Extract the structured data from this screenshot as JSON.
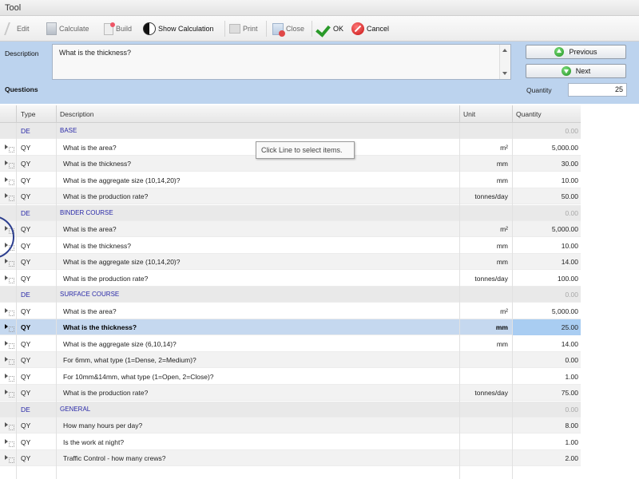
{
  "window": {
    "title": "Tool"
  },
  "toolbar": {
    "edit": "Edit",
    "calculate": "Calculate",
    "build": "Build",
    "show_calculation": "Show Calculation",
    "print": "Print",
    "close": "Close",
    "ok": "OK",
    "cancel": "Cancel"
  },
  "top_panel": {
    "description_label": "Description",
    "description_value": "What is the thickness?",
    "previous_label": "Previous",
    "next_label": "Next",
    "questions_label": "Questions",
    "quantity_label": "Quantity",
    "quantity_value": "25"
  },
  "grid": {
    "columns": {
      "type": "Type",
      "description": "Description",
      "unit": "Unit",
      "quantity": "Quantity"
    },
    "rows": [
      {
        "type": "DE",
        "description": "BASE",
        "unit": "",
        "quantity": "0.00",
        "kind": "de"
      },
      {
        "type": "QY",
        "description": "What is the area?",
        "unit": "m²",
        "quantity": "5,000.00",
        "kind": "qy"
      },
      {
        "type": "QY",
        "description": "What is the thickness?",
        "unit": "mm",
        "quantity": "30.00",
        "kind": "qy"
      },
      {
        "type": "QY",
        "description": "What is the aggregate size (10,14,20)?",
        "unit": "mm",
        "quantity": "10.00",
        "kind": "qy"
      },
      {
        "type": "QY",
        "description": "What is the production rate?",
        "unit": "tonnes/day",
        "quantity": "50.00",
        "kind": "qy"
      },
      {
        "type": "DE",
        "description": "BINDER COURSE",
        "unit": "",
        "quantity": "0.00",
        "kind": "de"
      },
      {
        "type": "QY",
        "description": "What is the area?",
        "unit": "m²",
        "quantity": "5,000.00",
        "kind": "qy"
      },
      {
        "type": "QY",
        "description": "What is the thickness?",
        "unit": "mm",
        "quantity": "10.00",
        "kind": "qy"
      },
      {
        "type": "QY",
        "description": "What is the aggregate size (10,14,20)?",
        "unit": "mm",
        "quantity": "14.00",
        "kind": "qy"
      },
      {
        "type": "QY",
        "description": "What is the production rate?",
        "unit": "tonnes/day",
        "quantity": "100.00",
        "kind": "qy"
      },
      {
        "type": "DE",
        "description": "SURFACE COURSE",
        "unit": "",
        "quantity": "0.00",
        "kind": "de"
      },
      {
        "type": "QY",
        "description": "What is the area?",
        "unit": "m²",
        "quantity": "5,000.00",
        "kind": "qy"
      },
      {
        "type": "QY",
        "description": "What is the thickness?",
        "unit": "mm",
        "quantity": "25.00",
        "kind": "selected"
      },
      {
        "type": "QY",
        "description": "What is the aggregate size (6,10,14)?",
        "unit": "mm",
        "quantity": "14.00",
        "kind": "qy"
      },
      {
        "type": "QY",
        "description": "For 6mm, what type (1=Dense, 2=Medium)?",
        "unit": "",
        "quantity": "0.00",
        "kind": "qy"
      },
      {
        "type": "QY",
        "description": "For 10mm&14mm, what type (1=Open, 2=Close)?",
        "unit": "",
        "quantity": "1.00",
        "kind": "qy"
      },
      {
        "type": "QY",
        "description": "What is the production rate?",
        "unit": "tonnes/day",
        "quantity": "75.00",
        "kind": "qy"
      },
      {
        "type": "DE",
        "description": "GENERAL",
        "unit": "",
        "quantity": "0.00",
        "kind": "de"
      },
      {
        "type": "QY",
        "description": "How many hours per day?",
        "unit": "",
        "quantity": "8.00",
        "kind": "qy"
      },
      {
        "type": "QY",
        "description": "Is the work at night?",
        "unit": "",
        "quantity": "1.00",
        "kind": "qy"
      },
      {
        "type": "QY",
        "description": "Traffic Control - how many crews?",
        "unit": "",
        "quantity": "2.00",
        "kind": "qy"
      }
    ]
  },
  "tooltip": {
    "text": "Click Line to select items."
  },
  "colors": {
    "panel": "#bcd3ee",
    "selected_row": "#c5d8ef",
    "de_text": "#2a2aa8",
    "ok_green": "#2a9a2a",
    "cancel_red": "#c61010"
  }
}
